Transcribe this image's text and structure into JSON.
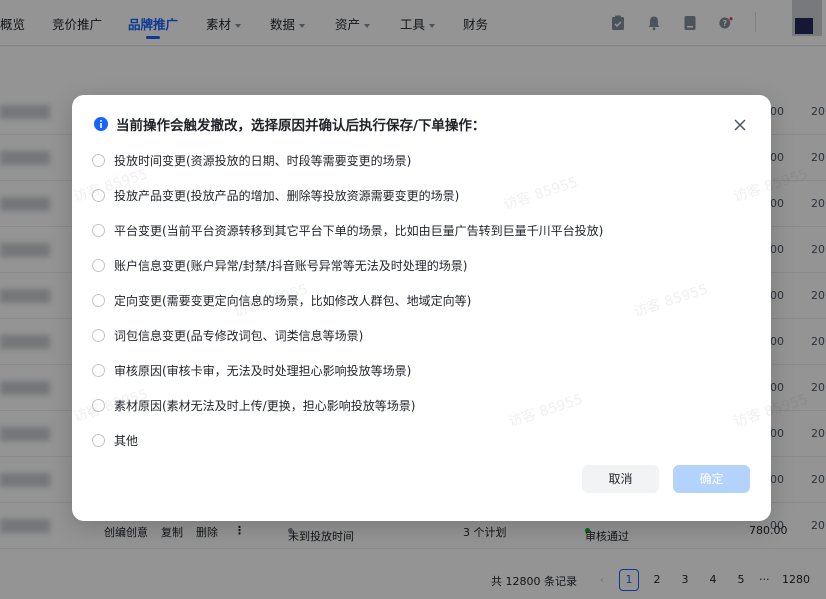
{
  "nav": {
    "items": [
      {
        "label": "概览",
        "dropdown": false,
        "active": false
      },
      {
        "label": "竞价推广",
        "dropdown": false,
        "active": false
      },
      {
        "label": "品牌推广",
        "dropdown": false,
        "active": true
      },
      {
        "label": "素材",
        "dropdown": true,
        "active": false
      },
      {
        "label": "数据",
        "dropdown": true,
        "active": false
      },
      {
        "label": "资产",
        "dropdown": true,
        "active": false
      },
      {
        "label": "工具",
        "dropdown": true,
        "active": false
      },
      {
        "label": "财务",
        "dropdown": false,
        "active": false
      }
    ],
    "icons": [
      "clipboard-icon",
      "bell-icon",
      "document-icon",
      "help-icon"
    ],
    "accent": "#1664ff"
  },
  "table": {
    "amount_fragments": [
      "00",
      "00",
      "00",
      "00",
      "00",
      "00",
      "00",
      "00",
      "00",
      "00"
    ],
    "year_fragments": [
      "20",
      "20",
      "20",
      "20",
      "20",
      "20",
      "20",
      "20",
      "20",
      "20"
    ],
    "last_row": {
      "actions": [
        "创编创意",
        "复制",
        "删除"
      ],
      "delivery_status": "未到投放时间",
      "plan_count": "3 个计划",
      "review_status": "审核通过",
      "amount": "780.00"
    }
  },
  "pagination": {
    "total": "共 12800 条记录",
    "pages": [
      "1",
      "2",
      "3",
      "4",
      "5"
    ],
    "ellipsis": "···",
    "last_page": "1280",
    "current": "1"
  },
  "dialog": {
    "title": "当前操作会触发撤改，选择原因并确认后执行保存/下单操作：",
    "options": [
      "投放时间变更(资源投放的日期、时段等需要变更的场景)",
      "投放产品变更(投放产品的增加、删除等投放资源需要变更的场景)",
      "平台变更(当前平台资源转移到其它平台下单的场景，比如由巨量广告转到巨量千川平台投放)",
      "账户信息变更(账户异常/封禁/抖音账号异常等无法及时处理的场景)",
      "定向变更(需要变更定向信息的场景，比如修改人群包、地域定向等)",
      "词包信息变更(品专修改词包、词类信息等场景)",
      "审核原因(审核卡审，无法及时处理担心影响投放等场景)",
      "素材原因(素材无法及时上传/更换，担心影响投放等场景)",
      "其他"
    ],
    "cancel_label": "取消",
    "confirm_label": "确定",
    "confirm_enabled": false
  },
  "watermark": "访客 85955"
}
